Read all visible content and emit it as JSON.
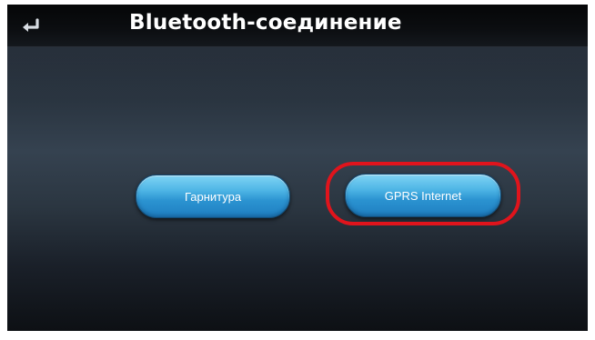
{
  "header": {
    "title": "Bluetooth-соединение",
    "back_icon": "back-return-arrow-icon"
  },
  "buttons": {
    "headset_label": "Гарнитура",
    "gprs_label": "GPRS Internet"
  },
  "annotation": {
    "highlight_color": "#e0141c"
  },
  "colors": {
    "button_accent": "#2b93d1",
    "title_text": "#ffffff"
  }
}
